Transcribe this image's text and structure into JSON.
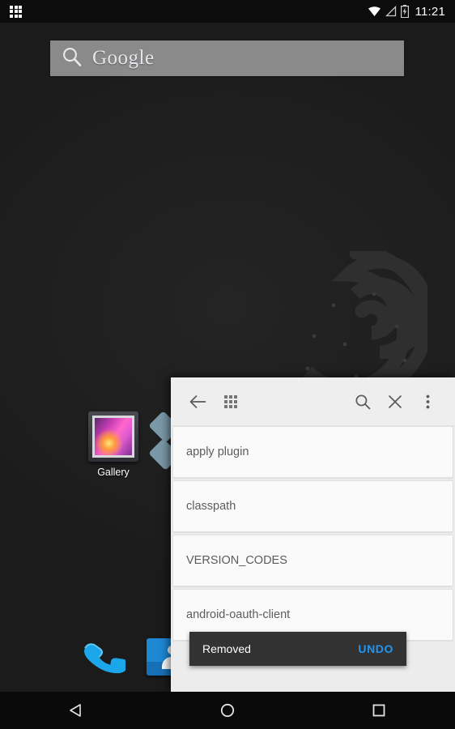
{
  "status_bar": {
    "apps_icon": "apps-grid-icon",
    "wifi_icon": "wifi-icon",
    "signal_icon": "cell-signal-icon",
    "battery_icon": "battery-charging-icon",
    "clock": "11:21"
  },
  "search": {
    "icon": "search-icon",
    "label": "Google",
    "placeholder": "Google"
  },
  "home": {
    "icons": [
      {
        "name": "gallery",
        "label": "Gallery"
      }
    ]
  },
  "dock": {
    "items": [
      {
        "name": "phone",
        "icon": "phone-icon"
      },
      {
        "name": "contacts",
        "icon": "contacts-icon"
      }
    ]
  },
  "dialog": {
    "toolbar": {
      "back_icon": "back-arrow-icon",
      "grid_icon": "apps-grid-icon",
      "search_icon": "search-icon",
      "close_icon": "close-icon",
      "overflow_icon": "more-vertical-icon"
    },
    "list": [
      {
        "text": "apply plugin"
      },
      {
        "text": "classpath"
      },
      {
        "text": "VERSION_CODES"
      },
      {
        "text": "android-oauth-client"
      }
    ],
    "snackbar": {
      "message": "Removed",
      "action": "UNDO",
      "action_color": "#2196f3",
      "background": "#323232"
    }
  },
  "nav_bar": {
    "back": "back-triangle-icon",
    "home": "home-circle-icon",
    "recents": "recents-square-icon"
  },
  "colors": {
    "wallpaper": "#1c1c1c",
    "status_bar": "#0c0c0c",
    "search_bar": "#8a8a8a",
    "dialog_bg": "#ececec",
    "card_bg": "#fafafa",
    "accent_blue": "#2196f3"
  }
}
